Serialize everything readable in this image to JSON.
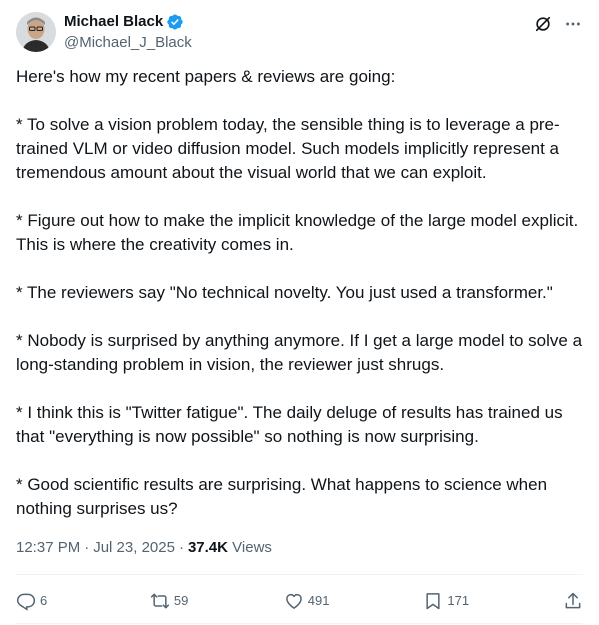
{
  "author": {
    "display_name": "Michael Black",
    "handle": "@Michael_J_Black",
    "verified": true
  },
  "tweet": {
    "paragraphs": [
      "Here's how my recent papers & reviews are going:",
      "* To solve a vision problem today, the sensible thing is to leverage a pre-trained VLM or video diffusion model. Such models implicitly represent a tremendous amount about the visual world that we can exploit.",
      "* Figure out how to make the implicit knowledge of the large model explicit. This is where the creativity comes in.",
      "* The reviewers say \"No technical novelty. You just used a transformer.\"",
      "* Nobody is surprised by anything anymore. If I get a large model to solve a long-standing problem in vision, the reviewer just shrugs.",
      "* I think this is \"Twitter fatigue\". The daily deluge of results has trained us that \"everything is now possible\" so nothing is now surprising.",
      "* Good scientific results are surprising. What happens to science when nothing surprises us?"
    ],
    "time": "12:37 PM",
    "date": "Jul 23, 2025",
    "views_count": "37.4K",
    "views_label": "Views"
  },
  "actions": {
    "replies": "6",
    "reposts": "59",
    "likes": "491",
    "bookmarks": "171"
  },
  "colors": {
    "text": "#0f1419",
    "muted": "#536471",
    "verified": "#1d9bf0",
    "divider": "#eff3f4"
  },
  "icons": {
    "verified": "verified-badge-icon",
    "grok": "grok-icon",
    "more": "more-icon",
    "reply": "reply-icon",
    "repost": "repost-icon",
    "like": "like-icon",
    "bookmark": "bookmark-icon",
    "share": "share-icon"
  }
}
